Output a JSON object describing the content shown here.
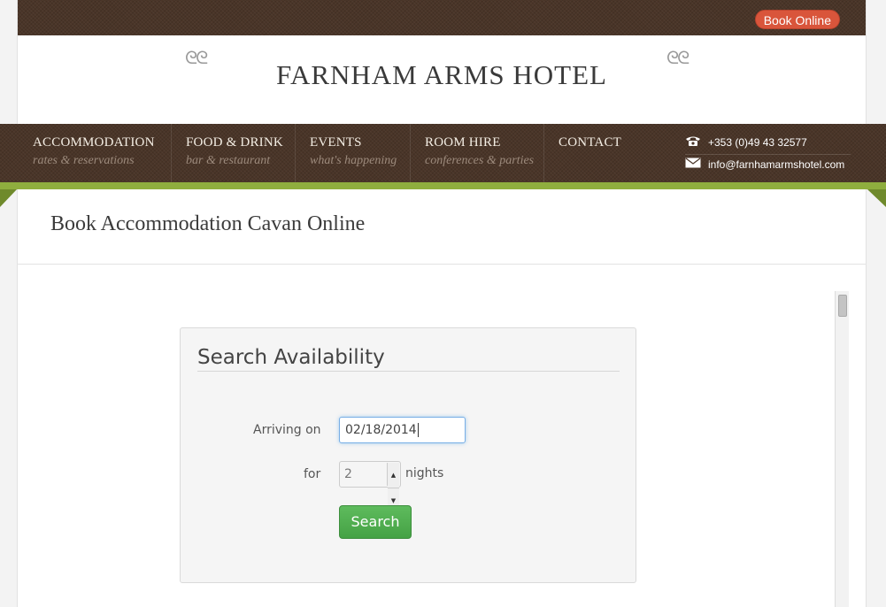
{
  "header": {
    "book_online": "Book Online",
    "hotel_name": "FARNHAM ARMS HOTEL"
  },
  "nav": [
    {
      "main": "ACCOMMODATION",
      "sub": "rates & reservations"
    },
    {
      "main": "FOOD & DRINK",
      "sub": "bar & restaurant"
    },
    {
      "main": "EVENTS",
      "sub": "what's happening"
    },
    {
      "main": "ROOM HIRE",
      "sub": "conferences & parties"
    },
    {
      "main": "CONTACT",
      "sub": ""
    }
  ],
  "contact": {
    "phone": "+353 (0)49 43 32577",
    "email": "info@farnhamarmshotel.com"
  },
  "page": {
    "heading": "Book Accommodation Cavan Online"
  },
  "search": {
    "title": "Search Availability",
    "arriving_label": "Arriving on",
    "arriving_value": "02/18/2014",
    "for_label": "for",
    "nights_value": "2",
    "nights_label": "nights",
    "search_button": "Search"
  },
  "colors": {
    "brown": "#4a3528",
    "green_accent": "#8fae3e",
    "book_online": "#d9553b",
    "search_button": "#4cae4c"
  }
}
